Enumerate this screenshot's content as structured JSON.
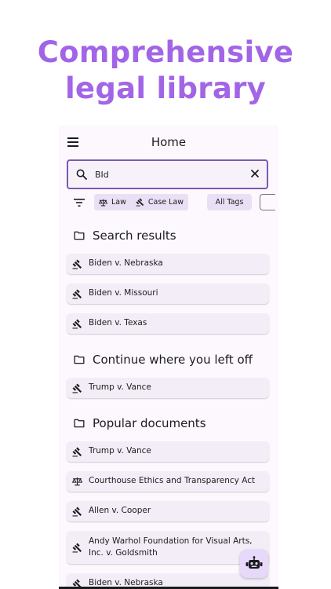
{
  "promo": {
    "line1": "Comprehensive",
    "line2": "legal library"
  },
  "appbar": {
    "title": "Home"
  },
  "search": {
    "value": "BId"
  },
  "filters": {
    "law": "Law",
    "case_law": "Case Law",
    "all_tags": "All Tags"
  },
  "sections": {
    "search_results": {
      "title": "Search results",
      "items": [
        {
          "label": "Biden v. Nebraska",
          "icon": "gavel-icon"
        },
        {
          "label": "Biden v. Missouri",
          "icon": "gavel-icon"
        },
        {
          "label": "Biden v. Texas",
          "icon": "gavel-icon"
        }
      ]
    },
    "continue": {
      "title": "Continue where you left off",
      "items": [
        {
          "label": "Trump v. Vance",
          "icon": "gavel-icon"
        }
      ]
    },
    "popular": {
      "title": "Popular documents",
      "items": [
        {
          "label": "Trump v. Vance",
          "icon": "gavel-icon"
        },
        {
          "label": "Courthouse Ethics and Transparency Act",
          "icon": "scale-icon"
        },
        {
          "label": "Allen v. Cooper",
          "icon": "gavel-icon"
        },
        {
          "label": "Andy Warhol Foundation for Visual Arts, Inc. v. Goldsmith",
          "icon": "gavel-icon"
        },
        {
          "label": "Biden v. Nebraska",
          "icon": "gavel-icon"
        }
      ]
    }
  },
  "colors": {
    "accent": "#a165e6",
    "card_bg": "#f3edf7",
    "chip_bg": "#e9e0f5",
    "border": "#7a5ab0"
  }
}
